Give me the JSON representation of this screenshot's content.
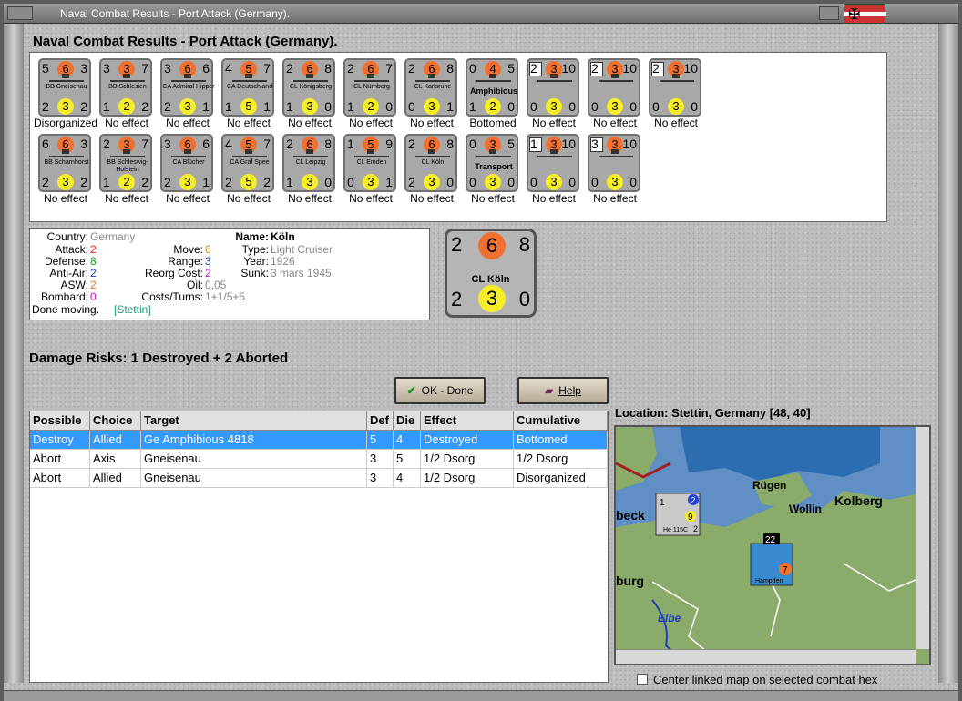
{
  "window": {
    "title": "Naval Combat Results - Port Attack (Germany)."
  },
  "header": {
    "title": "Naval Combat Results - Port Attack (Germany)."
  },
  "units": [
    {
      "name": "BB Gneisenau",
      "tl": "5",
      "top": "6",
      "tr": "3",
      "bl": "2",
      "bot": "3",
      "br": "2",
      "result": "Disorganized"
    },
    {
      "name": "BB Schlesien",
      "tl": "3",
      "top": "3",
      "tr": "7",
      "bl": "1",
      "bot": "2",
      "br": "2",
      "result": "No effect"
    },
    {
      "name": "CA Admiral Hipper",
      "tl": "3",
      "top": "6",
      "tr": "6",
      "bl": "2",
      "bot": "3",
      "br": "1",
      "result": "No effect"
    },
    {
      "name": "CA Deutschland",
      "tl": "4",
      "top": "5",
      "tr": "7",
      "bl": "1",
      "bot": "5",
      "br": "1",
      "result": "No effect"
    },
    {
      "name": "CL Königsberg",
      "tl": "2",
      "top": "6",
      "tr": "8",
      "bl": "1",
      "bot": "3",
      "br": "0",
      "result": "No effect"
    },
    {
      "name": "CL Nürnberg",
      "tl": "2",
      "top": "6",
      "tr": "7",
      "bl": "1",
      "bot": "2",
      "br": "0",
      "result": "No effect"
    },
    {
      "name": "CL Karlsruhe",
      "tl": "2",
      "top": "6",
      "tr": "8",
      "bl": "0",
      "bot": "3",
      "br": "1",
      "result": "No effect"
    },
    {
      "name": "Amphibious",
      "tl": "0",
      "top": "4",
      "tr": "5",
      "bl": "1",
      "bot": "2",
      "br": "0",
      "result": "Bottomed"
    },
    {
      "name": "",
      "tl": "2",
      "top": "3",
      "tr": "10",
      "bl": "0",
      "bot": "3",
      "br": "0",
      "result": "No effect"
    },
    {
      "name": "",
      "tl": "2",
      "top": "3",
      "tr": "10",
      "bl": "0",
      "bot": "3",
      "br": "0",
      "result": "No effect"
    },
    {
      "name": "",
      "tl": "2",
      "top": "3",
      "tr": "10",
      "bl": "0",
      "bot": "3",
      "br": "0",
      "result": "No effect"
    },
    {
      "name": "BB Scharnhorst",
      "tl": "6",
      "top": "6",
      "tr": "3",
      "bl": "2",
      "bot": "3",
      "br": "2",
      "result": "No effect"
    },
    {
      "name": "BB Schleswig-Holstein",
      "tl": "2",
      "top": "3",
      "tr": "7",
      "bl": "1",
      "bot": "2",
      "br": "2",
      "result": "No effect"
    },
    {
      "name": "CA Blücher",
      "tl": "3",
      "top": "6",
      "tr": "6",
      "bl": "2",
      "bot": "3",
      "br": "1",
      "result": "No effect"
    },
    {
      "name": "CA Graf Spee",
      "tl": "4",
      "top": "5",
      "tr": "7",
      "bl": "2",
      "bot": "5",
      "br": "2",
      "result": "No effect"
    },
    {
      "name": "CL Leipzig",
      "tl": "2",
      "top": "6",
      "tr": "8",
      "bl": "1",
      "bot": "3",
      "br": "0",
      "result": "No effect"
    },
    {
      "name": "CL Emden",
      "tl": "1",
      "top": "5",
      "tr": "9",
      "bl": "0",
      "bot": "3",
      "br": "1",
      "result": "No effect"
    },
    {
      "name": "CL Köln",
      "tl": "2",
      "top": "6",
      "tr": "8",
      "bl": "2",
      "bot": "3",
      "br": "0",
      "result": "No effect"
    },
    {
      "name": "Transport",
      "tl": "0",
      "top": "3",
      "tr": "5",
      "bl": "0",
      "bot": "3",
      "br": "0",
      "result": "No effect"
    },
    {
      "name": "",
      "tl": "1",
      "top": "3",
      "tr": "10",
      "bl": "0",
      "bot": "3",
      "br": "0",
      "result": "No effect"
    },
    {
      "name": "",
      "tl": "3",
      "top": "3",
      "tr": "10",
      "bl": "0",
      "bot": "3",
      "br": "0",
      "result": "No effect"
    }
  ],
  "info": {
    "country_label": "Country:",
    "country": "Germany",
    "attack_label": "Attack:",
    "attack": "2",
    "defense_label": "Defense:",
    "defense": "8",
    "antiair_label": "Anti-Air:",
    "antiair": "2",
    "asw_label": "ASW:",
    "asw": "2",
    "bombard_label": "Bombard:",
    "bombard": "0",
    "move_label": "Move:",
    "move": "6",
    "range_label": "Range:",
    "range": "3",
    "reorg_label": "Reorg Cost:",
    "reorg": "2",
    "oil_label": "Oil:",
    "oil": "0,05",
    "costs_label": "Costs/Turns:",
    "costs": "1+1/5+5",
    "name_label": "Name:",
    "name": "Köln",
    "type_label": "Type:",
    "type": "Light Cruiser",
    "year_label": "Year:",
    "year": "1926",
    "sunk_label": "Sunk:",
    "sunk": "3 mars 1945",
    "done_label": "Done moving.",
    "done_loc": "[Stettin]"
  },
  "big_chit": {
    "tl": "2",
    "top": "6",
    "tr": "8",
    "name": "CL Köln",
    "bl": "2",
    "bot": "3",
    "br": "0"
  },
  "damage": {
    "text": "Damage Risks:  1 Destroyed + 2 Aborted"
  },
  "buttons": {
    "ok": "OK - Done",
    "help": "Help"
  },
  "table": {
    "headers": [
      "Possible",
      "Choice",
      "Target",
      "Def",
      "Die",
      "Effect",
      "Cumulative"
    ],
    "rows": [
      [
        "Destroy",
        "Allied",
        "Ge Amphibious 4818",
        "5",
        "4",
        "Destroyed",
        "Bottomed"
      ],
      [
        "Abort",
        "Axis",
        "Gneisenau",
        "3",
        "5",
        "1/2 Dsorg",
        "1/2 Dsorg"
      ],
      [
        "Abort",
        "Allied",
        "Gneisenau",
        "3",
        "4",
        "1/2 Dsorg",
        "Disorganized"
      ]
    ]
  },
  "location": {
    "label": "Location:  Stettin, Germany [48, 40]"
  },
  "map": {
    "labels": [
      "Rügen",
      "Wollin",
      "Kolberg",
      "beck",
      "burg",
      "Elbe"
    ],
    "counter1": {
      "top": "1",
      "circle": "2",
      "value": "9",
      "name": "He 115C",
      "br": "2"
    },
    "counter2": {
      "top": "22",
      "value": "7",
      "name": "Hampden"
    }
  },
  "center_check": {
    "label": "Center linked map on selected combat hex"
  },
  "colors": {
    "attack": "#e02020",
    "defense": "#1a9a1a",
    "antiair": "#1a3aa0",
    "asw": "#e07a20",
    "bombard": "#c020c0",
    "selected_row": "#3399ff",
    "orange_circle": "#f07030",
    "yellow_circle": "#f5ed2a"
  }
}
